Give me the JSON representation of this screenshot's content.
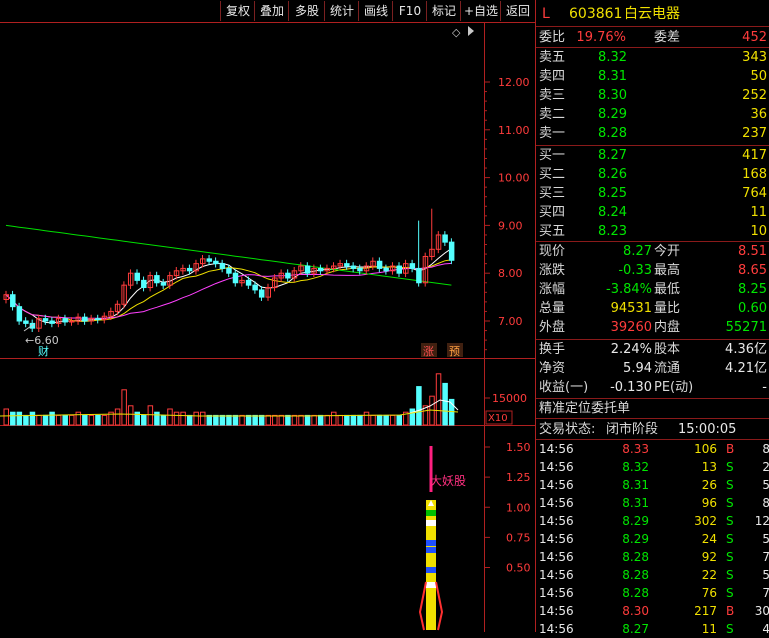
{
  "toolbar": {
    "buttons": [
      "复权",
      "叠加",
      "多股",
      "统计",
      "画线",
      "F10",
      "标记",
      "+自选",
      "返回"
    ]
  },
  "chart": {
    "price_ticks": [
      "12.00",
      "11.00",
      "10.00",
      "9.00",
      "8.00",
      "7.00"
    ],
    "low_label": "6.60",
    "markers": {
      "cai": "财",
      "zhang": "涨",
      "yu": "预"
    },
    "volume_tick": "15000",
    "volume_unit": "X10",
    "indicator_ticks": [
      "1.50",
      "1.25",
      "1.00",
      "0.75",
      "0.50"
    ],
    "indicator_label": "大妖股",
    "diamond_icon": "diamond-icon",
    "colors": {
      "up": "#ff3c3c",
      "down": "#54ffff",
      "ma5": "#ffffff",
      "ma10": "#f0e000",
      "ma20": "#ff40ff",
      "ma60": "#00e000",
      "axis": "#b02020"
    }
  },
  "quote": {
    "flag": "L",
    "code": "603861",
    "name": "白云电器",
    "weibi_label": "委比",
    "weibi": "19.76%",
    "weicha_label": "委差",
    "weicha": "452",
    "asks": [
      {
        "label": "卖五",
        "price": "8.32",
        "vol": "343"
      },
      {
        "label": "卖四",
        "price": "8.31",
        "vol": "50"
      },
      {
        "label": "卖三",
        "price": "8.30",
        "vol": "252"
      },
      {
        "label": "卖二",
        "price": "8.29",
        "vol": "36"
      },
      {
        "label": "卖一",
        "price": "8.28",
        "vol": "237"
      }
    ],
    "bids": [
      {
        "label": "买一",
        "price": "8.27",
        "vol": "417"
      },
      {
        "label": "买二",
        "price": "8.26",
        "vol": "168"
      },
      {
        "label": "买三",
        "price": "8.25",
        "vol": "764"
      },
      {
        "label": "买四",
        "price": "8.24",
        "vol": "11"
      },
      {
        "label": "买五",
        "price": "8.23",
        "vol": "10"
      }
    ],
    "stats": [
      {
        "l1": "现价",
        "v1": "8.27",
        "l2": "今开",
        "v2": "8.51",
        "c1": "green",
        "c2": "red"
      },
      {
        "l1": "涨跌",
        "v1": "-0.33",
        "l2": "最高",
        "v2": "8.65",
        "c1": "green",
        "c2": "red"
      },
      {
        "l1": "涨幅",
        "v1": "-3.84%",
        "l2": "最低",
        "v2": "8.25",
        "c1": "green",
        "c2": "green"
      },
      {
        "l1": "总量",
        "v1": "94531",
        "l2": "量比",
        "v2": "0.60",
        "c1": "yellow",
        "c2": "green"
      },
      {
        "l1": "外盘",
        "v1": "39260",
        "l2": "内盘",
        "v2": "55271",
        "c1": "red",
        "c2": "green"
      }
    ],
    "fin": [
      {
        "l1": "换手",
        "v1": "2.24%",
        "l2": "股本",
        "v2": "4.36亿"
      },
      {
        "l1": "净资",
        "v1": "5.94",
        "l2": "流通",
        "v2": "4.21亿"
      },
      {
        "l1": "收益(一)",
        "v1": "-0.130",
        "l2": "PE(动)",
        "v2": "-"
      }
    ],
    "precise_title": "精准定位委托单",
    "status_label": "交易状态:",
    "status_value": "闭市阶段",
    "status_time": "15:00:05",
    "trades": [
      {
        "time": "14:56",
        "price": "8.33",
        "vol": "106",
        "side": "B",
        "n": "8",
        "pc": "red",
        "sc": "red"
      },
      {
        "time": "14:56",
        "price": "8.32",
        "vol": "13",
        "side": "S",
        "n": "2",
        "pc": "green",
        "sc": "green"
      },
      {
        "time": "14:56",
        "price": "8.31",
        "vol": "26",
        "side": "S",
        "n": "5",
        "pc": "green",
        "sc": "green"
      },
      {
        "time": "14:56",
        "price": "8.31",
        "vol": "96",
        "side": "S",
        "n": "8",
        "pc": "green",
        "sc": "green"
      },
      {
        "time": "14:56",
        "price": "8.29",
        "vol": "302",
        "side": "S",
        "n": "12",
        "pc": "green",
        "sc": "green"
      },
      {
        "time": "14:56",
        "price": "8.29",
        "vol": "24",
        "side": "S",
        "n": "5",
        "pc": "green",
        "sc": "green"
      },
      {
        "time": "14:56",
        "price": "8.28",
        "vol": "92",
        "side": "S",
        "n": "7",
        "pc": "green",
        "sc": "green"
      },
      {
        "time": "14:56",
        "price": "8.28",
        "vol": "22",
        "side": "S",
        "n": "5",
        "pc": "green",
        "sc": "green"
      },
      {
        "time": "14:56",
        "price": "8.28",
        "vol": "76",
        "side": "S",
        "n": "7",
        "pc": "green",
        "sc": "green"
      },
      {
        "time": "14:56",
        "price": "8.30",
        "vol": "217",
        "side": "B",
        "n": "30",
        "pc": "red",
        "sc": "red"
      },
      {
        "time": "14:56",
        "price": "8.27",
        "vol": "11",
        "side": "S",
        "n": "4",
        "pc": "green",
        "sc": "green"
      }
    ]
  }
}
